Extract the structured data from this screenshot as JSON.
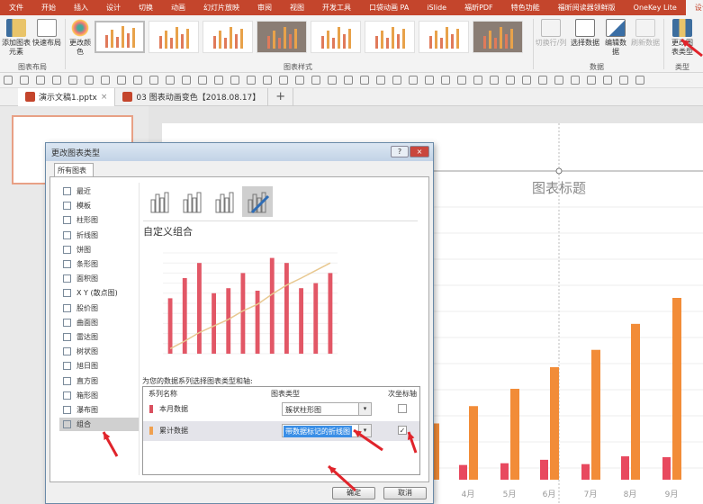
{
  "ribbon_tabs": [
    "文件",
    "开始",
    "插入",
    "设计",
    "切换",
    "动画",
    "幻灯片放映",
    "审阅",
    "视图",
    "开发工具",
    "口袋动画 PA",
    "iSlide",
    "福昕PDF",
    "特色功能",
    "福昕阅读器领鲜版",
    "OneKey Lite",
    "设计"
  ],
  "active_tab": "设计",
  "ribbon": {
    "add_element": "添加图表元素",
    "quick_layout": "快速布局",
    "group_layout": "图表布局",
    "change_color": "更改颜色",
    "group_styles": "图表样式",
    "switch_rowcol": "切换行/列",
    "select_data": "选择数据",
    "edit_data": "编辑数据",
    "refresh_data": "刷新数据",
    "group_data": "数据",
    "change_type": "更改图表类型",
    "group_type": "类型"
  },
  "doc_tabs": [
    {
      "label": "演示文稿1.pptx",
      "close": "×"
    },
    {
      "label": "03 图表动画变色【2018.08.17】"
    }
  ],
  "new_tab": "+",
  "slide_chart": {
    "title": "图表标题",
    "categories": [
      "4月",
      "5月",
      "6月",
      "7月",
      "8月",
      "9月"
    ],
    "series": [
      {
        "color": "#e8495f",
        "values": [
          17,
          19,
          23,
          18,
          27,
          26
        ]
      },
      {
        "color": "#f28c38",
        "values": [
          85,
          105,
          130,
          150,
          180,
          210
        ]
      }
    ]
  },
  "dialog": {
    "title": "更改图表类型",
    "help": "?",
    "close": "×",
    "tab": "所有图表",
    "categories": [
      "最近",
      "模板",
      "柱形图",
      "折线图",
      "饼图",
      "条形图",
      "面积图",
      "X Y (散点图)",
      "股价图",
      "曲面图",
      "雷达图",
      "树状图",
      "旭日图",
      "直方图",
      "箱形图",
      "瀑布图",
      "组合"
    ],
    "selected_category": "组合",
    "subtype_heading": "自定义组合",
    "series_prompt": "为您的数据系列选择图表类型和轴:",
    "table_headers": [
      "系列名称",
      "图表类型",
      "次坐标轴"
    ],
    "rows": [
      {
        "name": "本月数据",
        "color": "#d9505f",
        "type": "簇状柱形图",
        "secondary": false
      },
      {
        "name": "累计数据",
        "color": "#f0a050",
        "type": "带数据标记的折线图",
        "secondary": true
      }
    ],
    "ok": "确定",
    "cancel": "取消"
  },
  "chart_data": {
    "type": "bar",
    "series": [
      {
        "values": [
          110,
          150,
          180,
          120,
          130,
          160,
          125,
          190,
          180,
          130,
          140,
          160
        ],
        "color": "#e25766"
      },
      {
        "values": [
          10,
          25,
          42,
          55,
          68,
          85,
          98,
          118,
          136,
          150,
          165,
          180
        ],
        "color": "#e8c890"
      }
    ]
  }
}
